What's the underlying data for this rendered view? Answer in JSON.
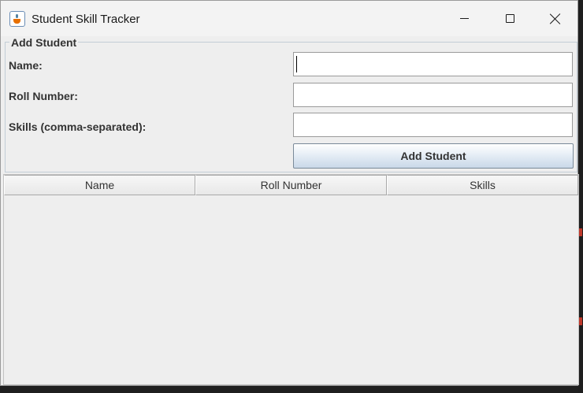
{
  "window": {
    "title": "Student Skill Tracker"
  },
  "form": {
    "title": "Add Student",
    "name_label": "Name:",
    "roll_label": "Roll Number:",
    "skills_label": "Skills (comma-separated):",
    "name_value": "",
    "roll_value": "",
    "skills_value": "",
    "submit_label": "Add Student"
  },
  "table": {
    "columns": [
      "Name",
      "Roll Number",
      "Skills"
    ],
    "rows": []
  },
  "icons": {
    "app": "java-cup-icon",
    "minimize": "minimize-icon",
    "maximize": "maximize-icon",
    "close": "close-icon"
  },
  "colors": {
    "window_bg": "#eeeeee",
    "button_gradient_bottom": "#c9d8e8",
    "panel_border": "#c2cdd6"
  }
}
